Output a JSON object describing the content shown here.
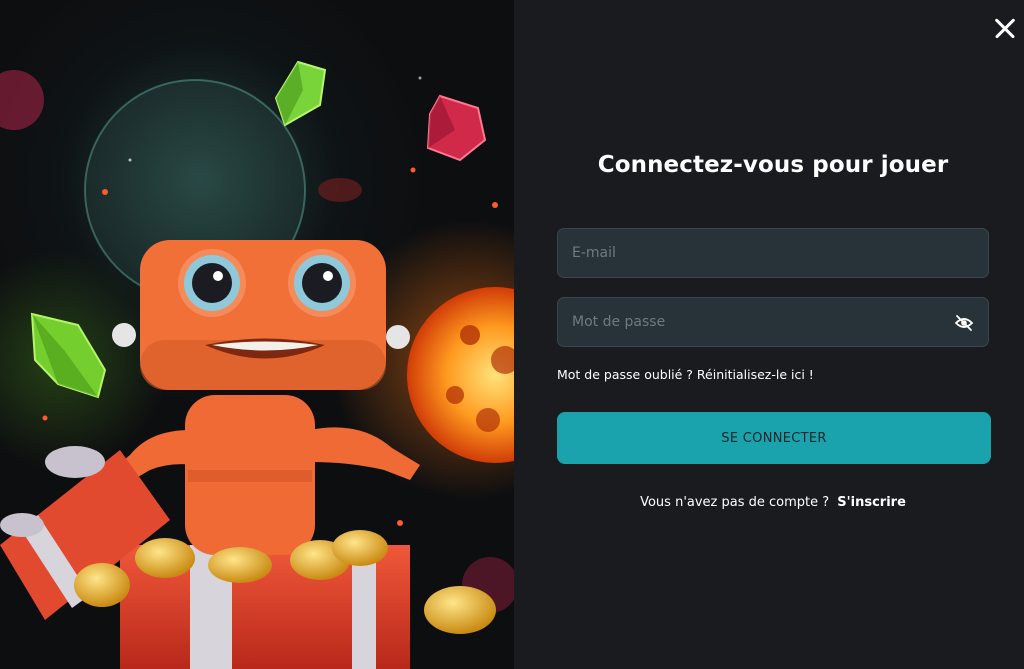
{
  "dialog": {
    "title": "Connectez-vous pour jouer",
    "close_icon": "close-icon"
  },
  "form": {
    "email": {
      "value": "",
      "placeholder": "E-mail"
    },
    "password": {
      "value": "",
      "placeholder": "Mot de passe",
      "toggle_icon": "eye-slash-icon"
    },
    "forgot_text": "Mot de passe oublié ? Réinitialisez-le ici !",
    "submit_label": "SE CONNECTER"
  },
  "signup": {
    "prompt": "Vous n'avez pas de compte ?",
    "link_label": "S'inscrire"
  },
  "colors": {
    "panel_bg": "#191b1e",
    "input_bg": "#283339",
    "accent": "#1aa3ad",
    "text": "#ffffff"
  }
}
